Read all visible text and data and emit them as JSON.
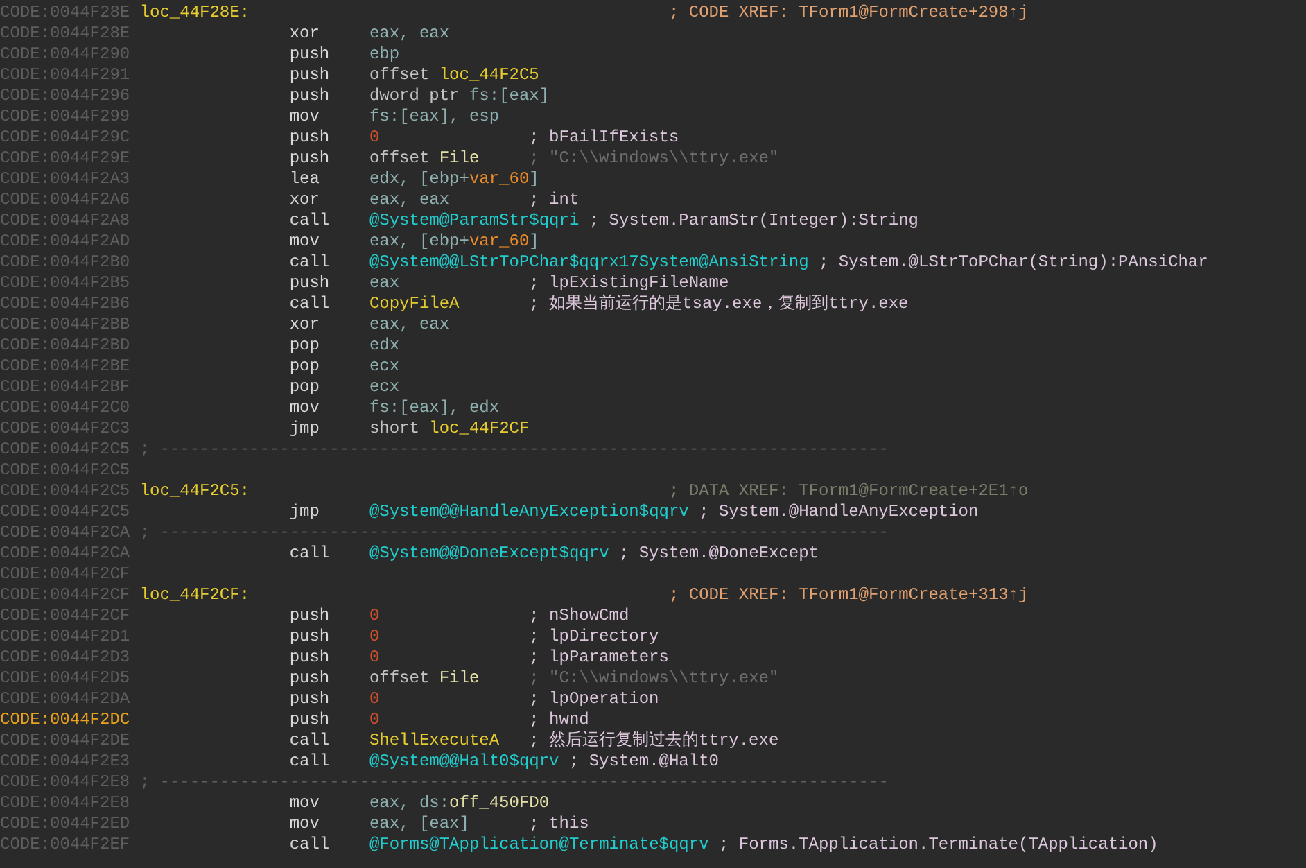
{
  "lines": [
    {
      "address": "CODE:0044F28E",
      "current": false,
      "kind": "label",
      "label": "loc_44F28E:",
      "comment": {
        "text": "; CODE XREF: TForm1@FormCreate+298↑j",
        "kind": "xref"
      }
    },
    {
      "address": "CODE:0044F28E",
      "current": false,
      "kind": "instr",
      "mnemonic": "xor",
      "operands": [
        {
          "text": "eax, eax",
          "kind": "reg"
        }
      ]
    },
    {
      "address": "CODE:0044F290",
      "current": false,
      "kind": "instr",
      "mnemonic": "push",
      "operands": [
        {
          "text": "ebp",
          "kind": "reg"
        }
      ]
    },
    {
      "address": "CODE:0044F291",
      "current": false,
      "kind": "instr",
      "mnemonic": "push",
      "operands": [
        {
          "text": "offset ",
          "kind": "kw"
        },
        {
          "text": "loc_44F2C5",
          "kind": "name"
        }
      ]
    },
    {
      "address": "CODE:0044F296",
      "current": false,
      "kind": "instr",
      "mnemonic": "push",
      "operands": [
        {
          "text": "dword ptr ",
          "kind": "kw"
        },
        {
          "text": "fs:[eax]",
          "kind": "reg"
        }
      ]
    },
    {
      "address": "CODE:0044F299",
      "current": false,
      "kind": "instr",
      "mnemonic": "mov",
      "operands": [
        {
          "text": "fs:[eax], esp",
          "kind": "reg"
        }
      ]
    },
    {
      "address": "CODE:0044F29C",
      "current": false,
      "kind": "instr",
      "mnemonic": "push",
      "operands": [
        {
          "text": "0",
          "kind": "num"
        }
      ],
      "comment": {
        "text": "; bFailIfExists",
        "kind": "plain"
      }
    },
    {
      "address": "CODE:0044F29E",
      "current": false,
      "kind": "instr",
      "mnemonic": "push",
      "operands": [
        {
          "text": "offset ",
          "kind": "kw"
        },
        {
          "text": "File",
          "kind": "data"
        }
      ],
      "comment": {
        "text": "; \"C:\\\\windows\\\\ttry.exe\"",
        "kind": "string"
      }
    },
    {
      "address": "CODE:0044F2A3",
      "current": false,
      "kind": "instr",
      "mnemonic": "lea",
      "operands": [
        {
          "text": "edx, [ebp+",
          "kind": "reg"
        },
        {
          "text": "var_60",
          "kind": "var"
        },
        {
          "text": "]",
          "kind": "reg"
        }
      ]
    },
    {
      "address": "CODE:0044F2A6",
      "current": false,
      "kind": "instr",
      "mnemonic": "xor",
      "operands": [
        {
          "text": "eax, eax",
          "kind": "reg"
        }
      ],
      "comment": {
        "text": "; int",
        "kind": "plain"
      }
    },
    {
      "address": "CODE:0044F2A8",
      "current": false,
      "kind": "instr",
      "mnemonic": "call",
      "operands": [
        {
          "text": "@System@ParamStr$qqri",
          "kind": "func"
        }
      ],
      "comment": {
        "text": "; System.ParamStr(Integer):String",
        "kind": "plain"
      }
    },
    {
      "address": "CODE:0044F2AD",
      "current": false,
      "kind": "instr",
      "mnemonic": "mov",
      "operands": [
        {
          "text": "eax, [ebp+",
          "kind": "reg"
        },
        {
          "text": "var_60",
          "kind": "var"
        },
        {
          "text": "]",
          "kind": "reg"
        }
      ]
    },
    {
      "address": "CODE:0044F2B0",
      "current": false,
      "kind": "instr",
      "mnemonic": "call",
      "operands": [
        {
          "text": "@System@@LStrToPChar$qqrx17System@AnsiString",
          "kind": "func"
        }
      ],
      "comment": {
        "text": "; System.@LStrToPChar(String):PAnsiChar",
        "kind": "plain"
      }
    },
    {
      "address": "CODE:0044F2B5",
      "current": false,
      "kind": "instr",
      "mnemonic": "push",
      "operands": [
        {
          "text": "eax",
          "kind": "reg"
        }
      ],
      "comment": {
        "text": "; lpExistingFileName",
        "kind": "plain"
      }
    },
    {
      "address": "CODE:0044F2B6",
      "current": false,
      "kind": "instr",
      "mnemonic": "call",
      "operands": [
        {
          "text": "CopyFileA",
          "kind": "name"
        }
      ],
      "comment": {
        "text": "; 如果当前运行的是tsay.exe，复制到ttry.exe",
        "kind": "plain"
      }
    },
    {
      "address": "CODE:0044F2BB",
      "current": false,
      "kind": "instr",
      "mnemonic": "xor",
      "operands": [
        {
          "text": "eax, eax",
          "kind": "reg"
        }
      ]
    },
    {
      "address": "CODE:0044F2BD",
      "current": false,
      "kind": "instr",
      "mnemonic": "pop",
      "operands": [
        {
          "text": "edx",
          "kind": "reg"
        }
      ]
    },
    {
      "address": "CODE:0044F2BE",
      "current": false,
      "kind": "instr",
      "mnemonic": "pop",
      "operands": [
        {
          "text": "ecx",
          "kind": "reg"
        }
      ]
    },
    {
      "address": "CODE:0044F2BF",
      "current": false,
      "kind": "instr",
      "mnemonic": "pop",
      "operands": [
        {
          "text": "ecx",
          "kind": "reg"
        }
      ]
    },
    {
      "address": "CODE:0044F2C0",
      "current": false,
      "kind": "instr",
      "mnemonic": "mov",
      "operands": [
        {
          "text": "fs:[eax], edx",
          "kind": "reg"
        }
      ]
    },
    {
      "address": "CODE:0044F2C3",
      "current": false,
      "kind": "instr",
      "mnemonic": "jmp",
      "operands": [
        {
          "text": "short ",
          "kind": "kw"
        },
        {
          "text": "loc_44F2CF",
          "kind": "name"
        }
      ]
    },
    {
      "address": "CODE:0044F2C5",
      "current": false,
      "kind": "separator",
      "text": "; -------------------------------------------------------------------------"
    },
    {
      "address": "CODE:0044F2C5",
      "current": false,
      "kind": "blank"
    },
    {
      "address": "CODE:0044F2C5",
      "current": false,
      "kind": "label",
      "label": "loc_44F2C5:",
      "comment": {
        "text": "; DATA XREF: TForm1@FormCreate+2E1↑o",
        "kind": "dxref"
      }
    },
    {
      "address": "CODE:0044F2C5",
      "current": false,
      "kind": "instr",
      "mnemonic": "jmp",
      "operands": [
        {
          "text": "@System@@HandleAnyException$qqrv",
          "kind": "func"
        }
      ],
      "comment": {
        "text": "; System.@HandleAnyException",
        "kind": "plain"
      }
    },
    {
      "address": "CODE:0044F2CA",
      "current": false,
      "kind": "separator",
      "text": "; -------------------------------------------------------------------------"
    },
    {
      "address": "CODE:0044F2CA",
      "current": false,
      "kind": "instr",
      "mnemonic": "call",
      "operands": [
        {
          "text": "@System@@DoneExcept$qqrv",
          "kind": "func"
        }
      ],
      "comment": {
        "text": "; System.@DoneExcept",
        "kind": "plain"
      }
    },
    {
      "address": "CODE:0044F2CF",
      "current": false,
      "kind": "blank"
    },
    {
      "address": "CODE:0044F2CF",
      "current": false,
      "kind": "label",
      "label": "loc_44F2CF:",
      "comment": {
        "text": "; CODE XREF: TForm1@FormCreate+313↑j",
        "kind": "xref"
      }
    },
    {
      "address": "CODE:0044F2CF",
      "current": false,
      "kind": "instr",
      "mnemonic": "push",
      "operands": [
        {
          "text": "0",
          "kind": "num"
        }
      ],
      "comment": {
        "text": "; nShowCmd",
        "kind": "plain"
      }
    },
    {
      "address": "CODE:0044F2D1",
      "current": false,
      "kind": "instr",
      "mnemonic": "push",
      "operands": [
        {
          "text": "0",
          "kind": "num"
        }
      ],
      "comment": {
        "text": "; lpDirectory",
        "kind": "plain"
      }
    },
    {
      "address": "CODE:0044F2D3",
      "current": false,
      "kind": "instr",
      "mnemonic": "push",
      "operands": [
        {
          "text": "0",
          "kind": "num"
        }
      ],
      "comment": {
        "text": "; lpParameters",
        "kind": "plain"
      }
    },
    {
      "address": "CODE:0044F2D5",
      "current": false,
      "kind": "instr",
      "mnemonic": "push",
      "operands": [
        {
          "text": "offset ",
          "kind": "kw"
        },
        {
          "text": "File",
          "kind": "data"
        }
      ],
      "comment": {
        "text": "; \"C:\\\\windows\\\\ttry.exe\"",
        "kind": "string"
      }
    },
    {
      "address": "CODE:0044F2DA",
      "current": false,
      "kind": "instr",
      "mnemonic": "push",
      "operands": [
        {
          "text": "0",
          "kind": "num"
        }
      ],
      "comment": {
        "text": "; lpOperation",
        "kind": "plain"
      }
    },
    {
      "address": "CODE:0044F2DC",
      "current": true,
      "kind": "instr",
      "mnemonic": "push",
      "operands": [
        {
          "text": "0",
          "kind": "num"
        }
      ],
      "comment": {
        "text": "; hwnd",
        "kind": "plain"
      }
    },
    {
      "address": "CODE:0044F2DE",
      "current": false,
      "kind": "instr",
      "mnemonic": "call",
      "operands": [
        {
          "text": "ShellExecuteA",
          "kind": "name"
        }
      ],
      "comment": {
        "text": "; 然后运行复制过去的ttry.exe",
        "kind": "plain"
      }
    },
    {
      "address": "CODE:0044F2E3",
      "current": false,
      "kind": "instr",
      "mnemonic": "call",
      "operands": [
        {
          "text": "@System@@Halt0$qqrv",
          "kind": "func"
        }
      ],
      "comment": {
        "text": "; System.@Halt0",
        "kind": "plain"
      }
    },
    {
      "address": "CODE:0044F2E8",
      "current": false,
      "kind": "separator",
      "text": "; -------------------------------------------------------------------------"
    },
    {
      "address": "CODE:0044F2E8",
      "current": false,
      "kind": "instr",
      "mnemonic": "mov",
      "operands": [
        {
          "text": "eax, ds:",
          "kind": "reg"
        },
        {
          "text": "off_450FD0",
          "kind": "data"
        }
      ]
    },
    {
      "address": "CODE:0044F2ED",
      "current": false,
      "kind": "instr",
      "mnemonic": "mov",
      "operands": [
        {
          "text": "eax, [eax]",
          "kind": "reg"
        }
      ],
      "comment": {
        "text": "; this",
        "kind": "plain"
      }
    },
    {
      "address": "CODE:0044F2EF",
      "current": false,
      "kind": "instr",
      "mnemonic": "call",
      "operands": [
        {
          "text": "@Forms@TApplication@Terminate$qqrv",
          "kind": "func"
        }
      ],
      "comment": {
        "text": "; Forms.TApplication.Terminate(TApplication)",
        "kind": "plain"
      }
    }
  ]
}
